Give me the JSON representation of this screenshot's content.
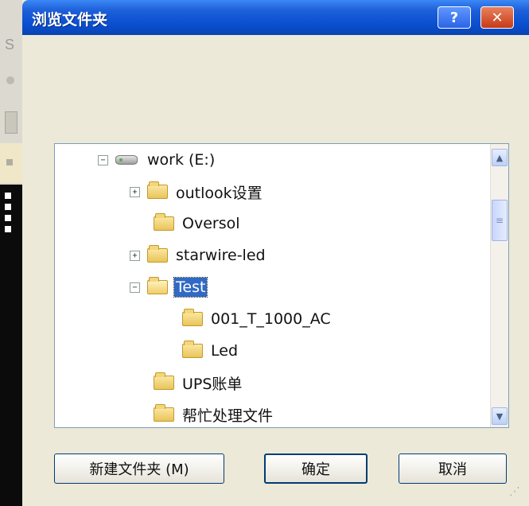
{
  "window": {
    "title": "浏览文件夹",
    "help_label": "?",
    "close_label": "✕"
  },
  "background": {
    "side_letter": "S"
  },
  "tree": {
    "items": [
      {
        "label": "work (E:)",
        "expander": "−",
        "icon": "drive-icon"
      },
      {
        "label": "outlook设置",
        "expander": "+",
        "icon": "folder-icon"
      },
      {
        "label": "Oversol",
        "expander": "",
        "icon": "folder-icon"
      },
      {
        "label": "starwire-led",
        "expander": "+",
        "icon": "folder-icon"
      },
      {
        "label": "Test",
        "expander": "−",
        "icon": "folder-open-icon",
        "selected": true
      },
      {
        "label": "001_T_1000_AC",
        "expander": "",
        "icon": "folder-icon"
      },
      {
        "label": "Led",
        "expander": "",
        "icon": "folder-icon"
      },
      {
        "label": "UPS账单",
        "expander": "",
        "icon": "folder-icon"
      },
      {
        "label": "帮忙处理文件",
        "expander": "",
        "icon": "folder-icon"
      }
    ]
  },
  "scrollbar": {
    "up": "▲",
    "down": "▼",
    "thumb_grip": "≡"
  },
  "buttons": {
    "new_folder": "新建文件夹 (M)",
    "ok": "确定",
    "cancel": "取消"
  },
  "colors": {
    "title_bar": "#0a4fd0",
    "selection": "#316ac5",
    "dialog_bg": "#ece9d8"
  }
}
